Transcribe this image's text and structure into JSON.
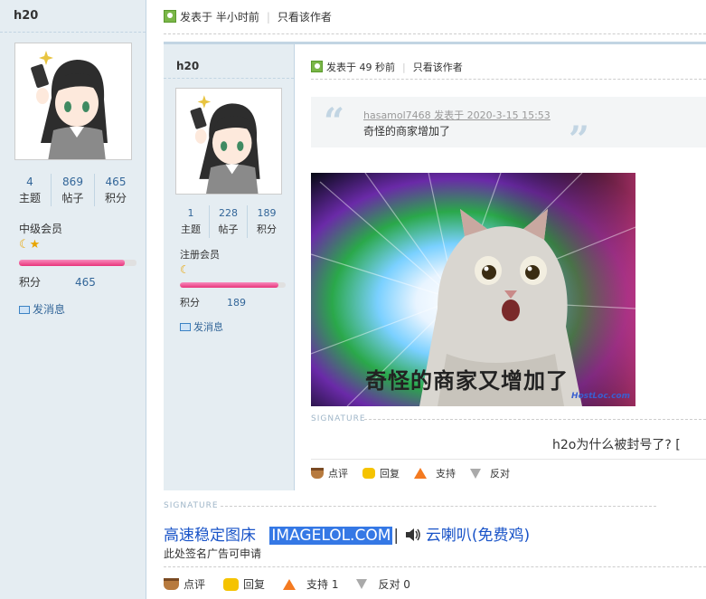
{
  "outer_author": {
    "name": "h20",
    "stats": [
      {
        "num": "4",
        "label": "主题"
      },
      {
        "num": "869",
        "label": "帖子"
      },
      {
        "num": "465",
        "label": "积分"
      }
    ],
    "group": "中级会员",
    "credit_label": "积分",
    "credit_value": "465",
    "progress": 0.9,
    "message_label": "发消息"
  },
  "outer_post": {
    "posted_label": "发表于 半小时前",
    "only_author": "只看该作者"
  },
  "nested_author": {
    "name": "h20",
    "stats": [
      {
        "num": "1",
        "label": "主题"
      },
      {
        "num": "228",
        "label": "帖子"
      },
      {
        "num": "189",
        "label": "积分"
      }
    ],
    "group": "注册会员",
    "credit_label": "积分",
    "credit_value": "189",
    "progress": 0.93,
    "message_label": "发消息"
  },
  "nested_post": {
    "posted_label": "发表于 49 秒前",
    "only_author": "只看该作者",
    "quote_line1": "hasamol7468 发表于 2020-3-15 15:53",
    "quote_line2": "奇怪的商家增加了",
    "meme_caption": "奇怪的商家又增加了",
    "meme_watermark": "HostLoc.com",
    "signature_label": "SIGNATURE",
    "signature_text": "h2o为什么被封号了? [",
    "actions": [
      {
        "label": "点评"
      },
      {
        "label": "回复"
      },
      {
        "label": "支持"
      },
      {
        "label": "反对"
      }
    ]
  },
  "outer_signature": {
    "label": "SIGNATURE",
    "link1": "高速稳定图床",
    "link2": "IMAGELOL.COM",
    "separator": "|",
    "link3": "云喇叭(免费鸡)",
    "note": "此处签名广告可申请"
  },
  "outer_actions": [
    {
      "label": "点评"
    },
    {
      "label": "回复"
    },
    {
      "label": "支持 1"
    },
    {
      "label": "反对 0"
    }
  ]
}
